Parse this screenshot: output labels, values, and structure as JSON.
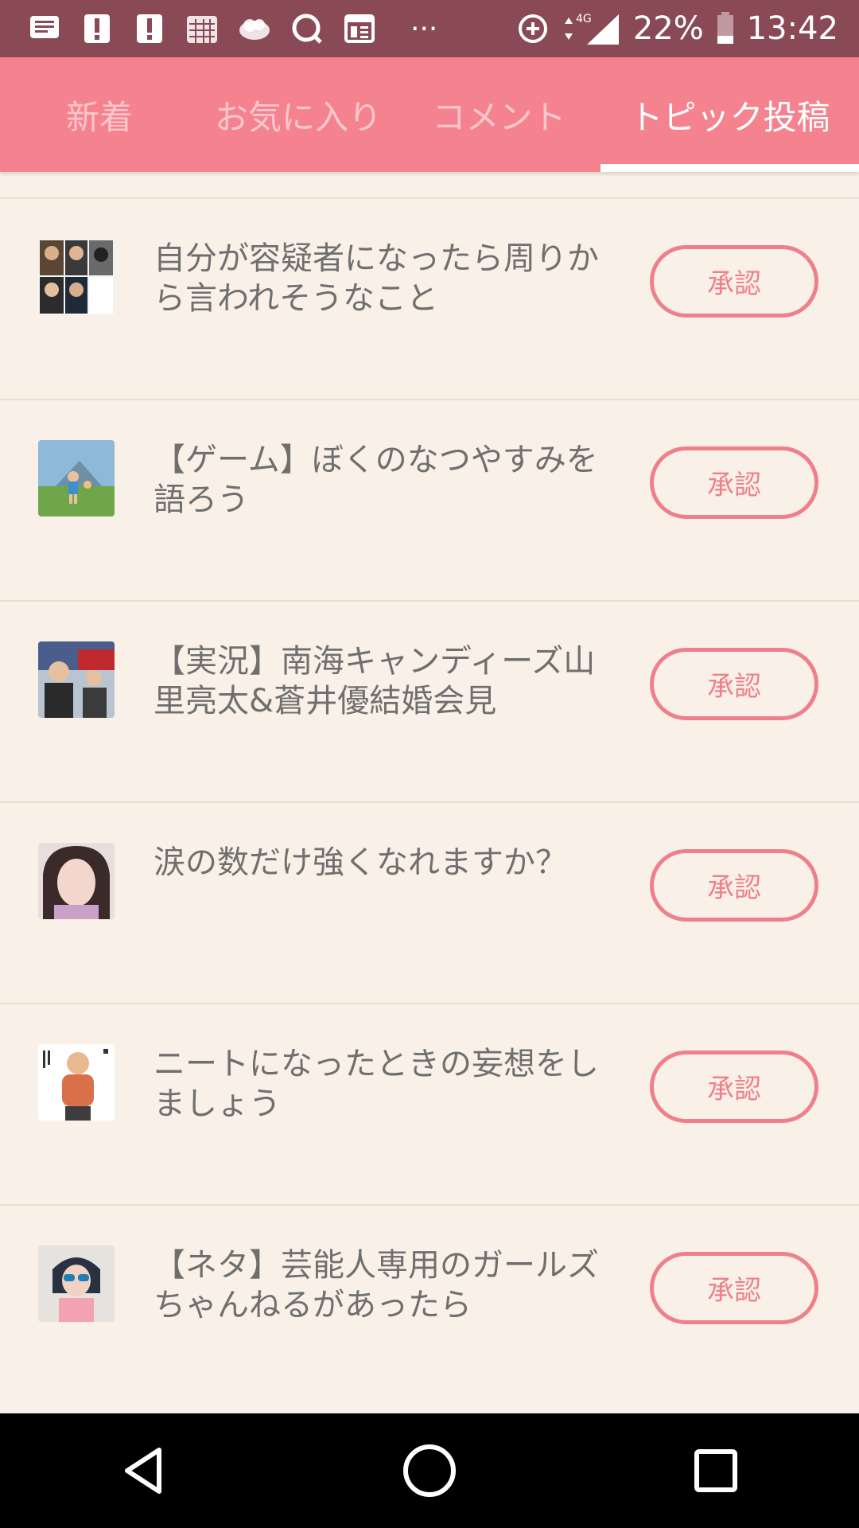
{
  "status_bar": {
    "battery": "22%",
    "time": "13:42",
    "network": "4G",
    "dots": "···",
    "icons": [
      "message-icon",
      "alert-icon",
      "alert-icon",
      "calendar-icon",
      "cloud-icon",
      "search-icon",
      "news-icon"
    ]
  },
  "tabs": [
    {
      "label": "新着"
    },
    {
      "label": "お気に入り"
    },
    {
      "label": "コメント"
    },
    {
      "label": "トピック投稿"
    }
  ],
  "topics": [
    {
      "title": "自分が容疑者になったら周りから言われそうなこと",
      "button": "承認"
    },
    {
      "title": "【ゲーム】ぼくのなつやすみを語ろう",
      "button": "承認"
    },
    {
      "title": "【実況】南海キャンディーズ山里亮太&蒼井優結婚会見",
      "button": "承認"
    },
    {
      "title": "涙の数だけ強くなれますか？",
      "button": "承認"
    },
    {
      "title": "ニートになったときの妄想をしましょう",
      "button": "承認"
    },
    {
      "title": "【ネタ】芸能人専用のガールズちゃんねるがあったら",
      "button": "承認"
    }
  ],
  "colors": {
    "status_bar": "#8a4a55",
    "tab_bar": "#f5838f",
    "background": "#f9f1e7",
    "accent": "#ef7f8b"
  }
}
